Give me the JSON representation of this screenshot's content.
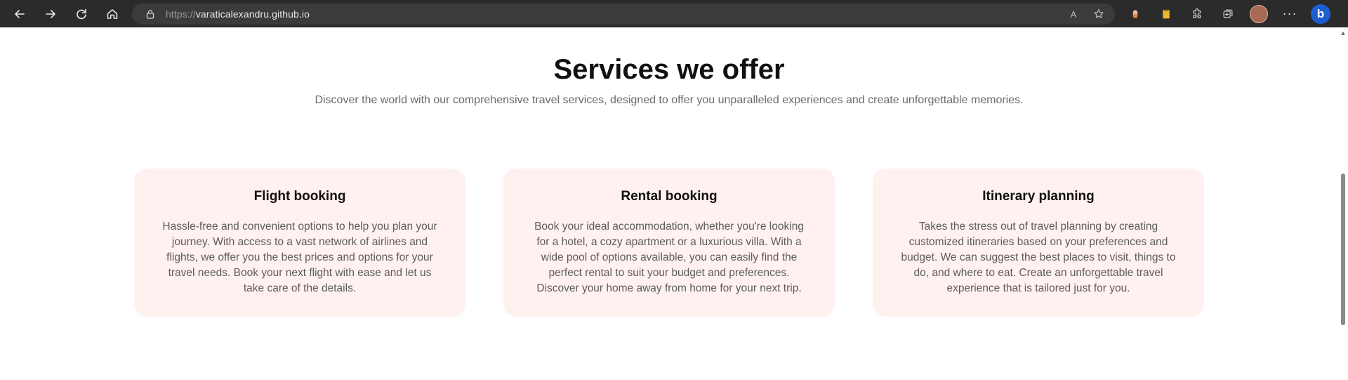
{
  "browser": {
    "url_protocol": "https://",
    "url_host": "varaticalexandru.github.io",
    "icons": {
      "back": "back-arrow-icon",
      "forward": "forward-arrow-icon",
      "refresh": "refresh-icon",
      "home": "home-icon",
      "lock": "lock-icon",
      "read_aloud": "read-aloud-icon",
      "favorite": "add-favorite-icon",
      "extensions": "puzzle-icon",
      "collections": "collections-icon",
      "more": "more-icon",
      "bing": "bing-copilot-icon"
    },
    "read_aloud_glyph": "A",
    "more_glyph": "···",
    "bing_glyph": "b"
  },
  "services": {
    "title": "Services we offer",
    "subtitle": "Discover the world with our comprehensive travel services, designed to offer you unparalleled experiences and create unforgettable memories.",
    "cards": [
      {
        "title": "Flight booking",
        "text": "Hassle-free and convenient options to help you plan your journey. With access to a vast network of airlines and flights, we offer you the best prices and options for your travel needs. Book your next flight with ease and let us take care of the details."
      },
      {
        "title": "Rental booking",
        "text": "Book your ideal accommodation, whether you're looking for a hotel, a cozy apartment or a luxurious villa. With a wide pool of options available, you can easily find the perfect rental to suit your budget and preferences. Discover your home away from home for your next trip."
      },
      {
        "title": "Itinerary planning",
        "text": "Takes the stress out of travel planning by creating customized itineraries based on your preferences and budget. We can suggest the best places to visit, things to do, and where to eat. Create an unforgettable travel experience that is tailored just for you."
      }
    ]
  },
  "colors": {
    "card_background": "#fff1f0",
    "browser_bar": "#2b2b2b",
    "title_text": "#111111",
    "body_text": "#5c5c5c"
  }
}
